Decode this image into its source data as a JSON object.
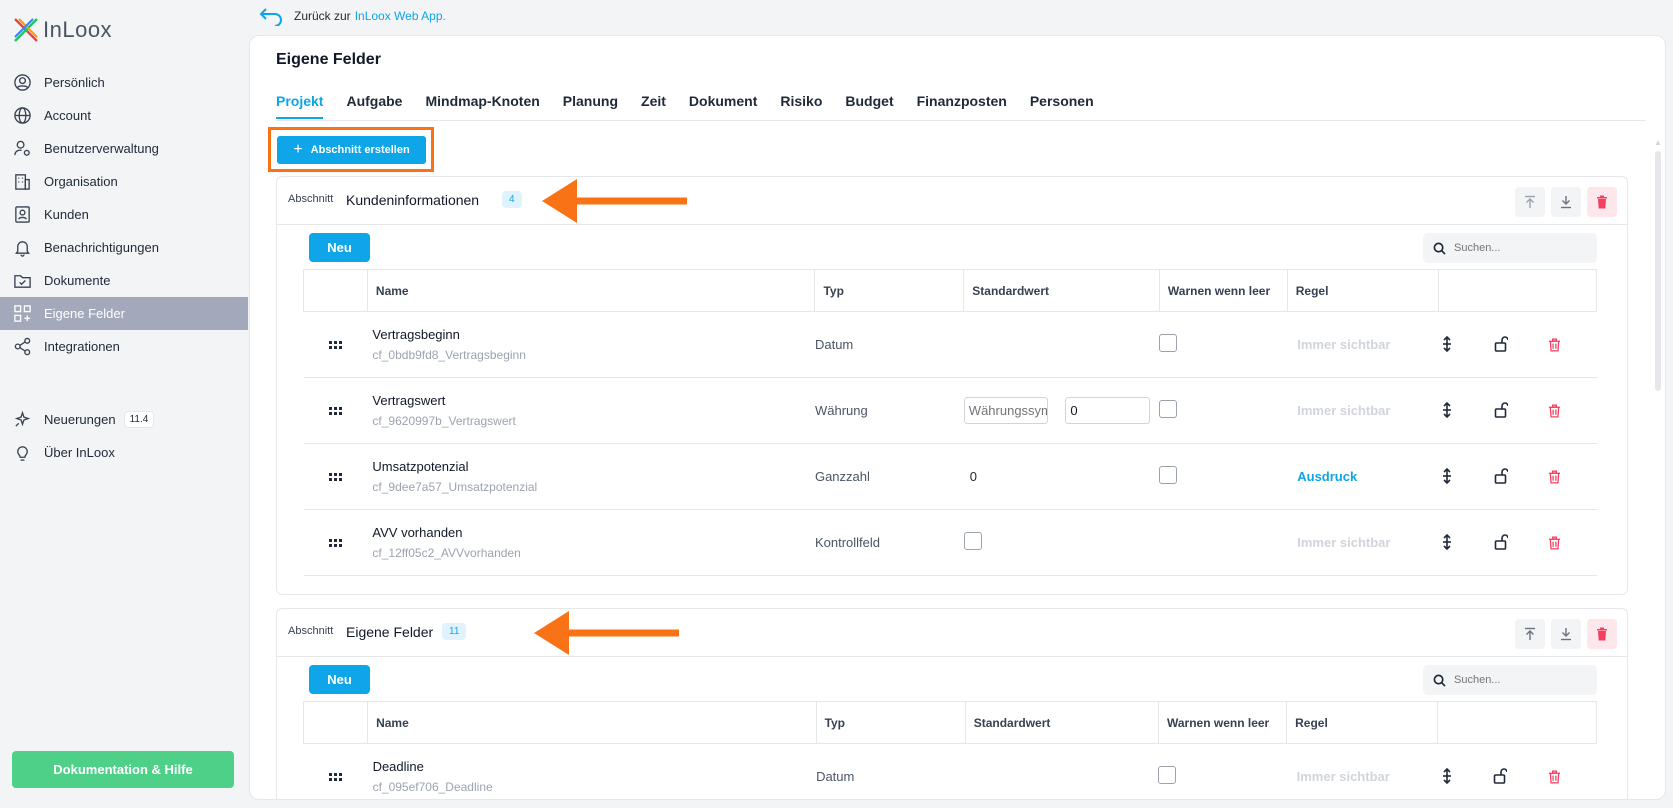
{
  "brand": {
    "name": "InLoox"
  },
  "sidebar": {
    "items": [
      {
        "label": "Persönlich"
      },
      {
        "label": "Account"
      },
      {
        "label": "Benutzerverwaltung"
      },
      {
        "label": "Organisation"
      },
      {
        "label": "Kunden"
      },
      {
        "label": "Benachrichtigungen"
      },
      {
        "label": "Dokumente"
      },
      {
        "label": "Eigene Felder",
        "active": true
      },
      {
        "label": "Integrationen"
      }
    ],
    "extra": [
      {
        "label": "Neuerungen",
        "badge": "11.4"
      },
      {
        "label": "Über InLoox"
      }
    ],
    "help_button": "Dokumentation & Hilfe"
  },
  "back": {
    "text": "Zurück zur",
    "link": "InLoox Web App."
  },
  "page": {
    "title": "Eigene Felder",
    "tabs": [
      "Projekt",
      "Aufgabe",
      "Mindmap-Knoten",
      "Planung",
      "Zeit",
      "Dokument",
      "Risiko",
      "Budget",
      "Finanzposten",
      "Personen"
    ],
    "active_tab": "Projekt",
    "create_button": "Abschnitt erstellen"
  },
  "table_headers": [
    "Name",
    "Typ",
    "Standardwert",
    "Warnen wenn leer",
    "Regel"
  ],
  "sections": [
    {
      "label": "Abschnitt",
      "name": "Kundeninformationen",
      "count": "4",
      "new_button": "Neu",
      "search_placeholder": "Suchen...",
      "rows": [
        {
          "name": "Vertragsbeginn",
          "id": "cf_0bdb9fd8_Vertragsbeginn",
          "type": "Datum",
          "default": "",
          "rule": "Immer sichtbar",
          "rule_active": false
        },
        {
          "name": "Vertragswert",
          "id": "cf_9620997b_Vertragswert",
          "type": "Währung",
          "currency_placeholder": "Währungssymbol",
          "default": "0",
          "rule": "Immer sichtbar",
          "rule_active": false
        },
        {
          "name": "Umsatzpotenzial",
          "id": "cf_9dee7a57_Umsatzpotenzial",
          "type": "Ganzzahl",
          "default": "0",
          "rule": "Ausdruck",
          "rule_active": true
        },
        {
          "name": "AVV vorhanden",
          "id": "cf_12ff05c2_AVVvorhanden",
          "type": "Kontrollfeld",
          "default": "",
          "rule": "Immer sichtbar",
          "rule_active": false
        }
      ]
    },
    {
      "label": "Abschnitt",
      "name": "Eigene Felder",
      "count": "11",
      "new_button": "Neu",
      "search_placeholder": "Suchen...",
      "rows": [
        {
          "name": "Deadline",
          "id": "cf_095ef706_Deadline",
          "type": "Datum",
          "default": "",
          "rule": "Immer sichtbar",
          "rule_active": false
        }
      ]
    }
  ],
  "colors": {
    "accent": "#0ea5e9",
    "highlight": "#f97316",
    "help": "#4fd089",
    "active_nav": "#a3a9bb",
    "danger": "#f43f5e"
  }
}
